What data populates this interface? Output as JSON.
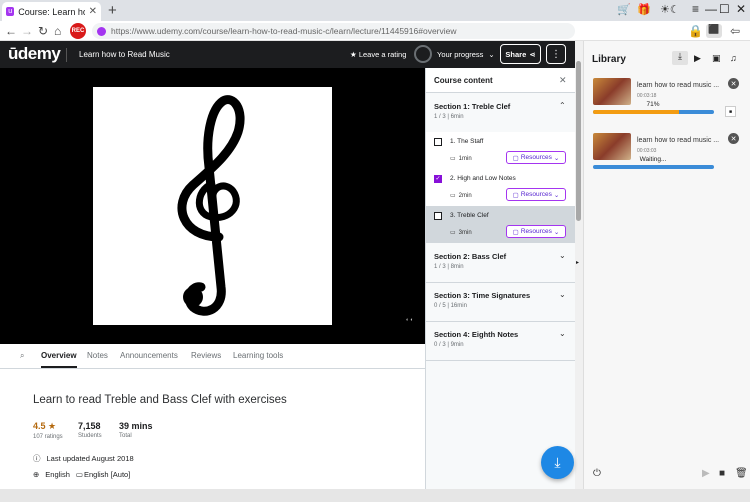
{
  "browser": {
    "tab_title": "Course: Learn how to",
    "url": "https://www.udemy.com/course/learn-how-to-read-music-c/learn/lecture/11445916#overview",
    "rec_label": "REC"
  },
  "header": {
    "logo": "ūdemy",
    "course_title": "Learn how to Read Music",
    "rating_label": "Leave a rating",
    "progress_label": "Your progress",
    "share_label": "Share"
  },
  "tabs": [
    "Overview",
    "Notes",
    "Announcements",
    "Reviews",
    "Learning tools"
  ],
  "overview": {
    "title": "Learn to read Treble and Bass Clef with exercises",
    "rating": "4.5 ★",
    "rating_label": "107 ratings",
    "students": "7,158",
    "students_label": "Students",
    "total": "39 mins",
    "total_label": "Total",
    "updated": "Last updated August 2018",
    "language": "English",
    "captions": "English [Auto]"
  },
  "course_content": {
    "title": "Course content",
    "sections": [
      {
        "name": "Section 1: Treble Clef",
        "meta": "1 / 3 | 6min"
      },
      {
        "name": "Section 2: Bass Clef",
        "meta": "1 / 3 | 8min"
      },
      {
        "name": "Section 3: Time Signatures",
        "meta": "0 / 5 | 16min"
      },
      {
        "name": "Section 4: Eighth Notes",
        "meta": "0 / 3 | 9min"
      }
    ],
    "lectures": [
      {
        "title": "1. The Staff",
        "duration": "1min",
        "resources": "Resources",
        "checked": false
      },
      {
        "title": "2. High and Low Notes",
        "duration": "2min",
        "resources": "Resources",
        "checked": true
      },
      {
        "title": "3. Treble Clef",
        "duration": "3min",
        "resources": "Resources",
        "checked": false
      }
    ]
  },
  "library": {
    "title": "Library",
    "items": [
      {
        "name": "learn how to read music ...",
        "time": "00:03:18",
        "status": "71%",
        "progress": 0.71
      },
      {
        "name": "learn how to read music ...",
        "time": "00:03:03",
        "status": "Waiting...",
        "progress": 0
      }
    ]
  }
}
